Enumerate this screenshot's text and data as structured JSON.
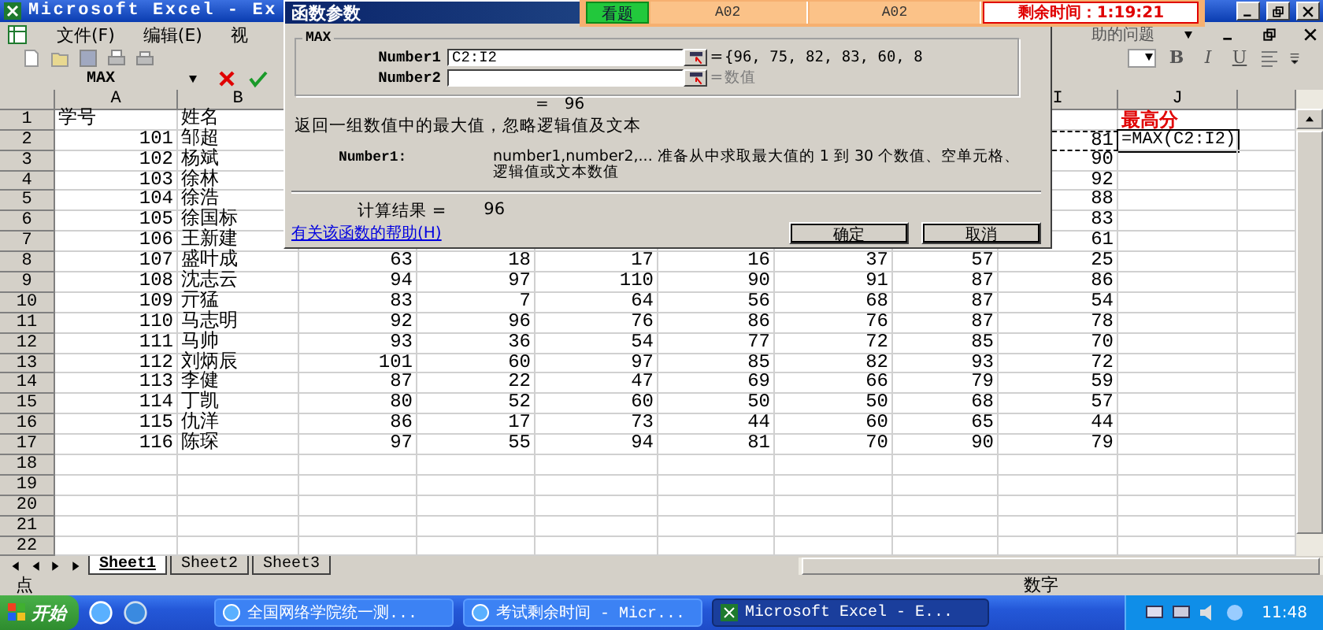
{
  "window": {
    "title": "Microsoft Excel - Ex"
  },
  "menu": [
    "文件(F)",
    "编辑(E)",
    "视"
  ],
  "help_question": "助的问题",
  "format_buttons": [
    "B",
    "I",
    "U"
  ],
  "name_box": "MAX",
  "exam_bar": {
    "view_button": "看题",
    "fields": [
      "A02",
      "A02"
    ],
    "timer": "剩余时间：1:19:21"
  },
  "columns": [
    "A",
    "B",
    null,
    null,
    null,
    null,
    null,
    null,
    "I",
    "J"
  ],
  "rows": [
    {
      "n": "1",
      "kind": "header",
      "cells": [
        "学号",
        "姓名",
        null,
        null,
        null,
        null,
        null,
        null,
        null
      ],
      "j": {
        "kind": "title",
        "text": "最高分"
      }
    },
    {
      "n": "2",
      "kind": "data",
      "reference": true,
      "cells": [
        "101",
        "邹超",
        null,
        null,
        null,
        null,
        null,
        null,
        "81"
      ],
      "j": {
        "kind": "formula",
        "text": "=MAX(C2:I2)"
      }
    },
    {
      "n": "3",
      "kind": "data",
      "cells": [
        "102",
        "杨斌",
        null,
        null,
        null,
        null,
        null,
        null,
        "90"
      ]
    },
    {
      "n": "4",
      "kind": "data",
      "cells": [
        "103",
        "徐林",
        null,
        null,
        null,
        null,
        null,
        null,
        "92"
      ]
    },
    {
      "n": "5",
      "kind": "data",
      "cells": [
        "104",
        "徐浩",
        null,
        null,
        null,
        null,
        null,
        null,
        "88"
      ]
    },
    {
      "n": "6",
      "kind": "data",
      "cells": [
        "105",
        "徐国标",
        null,
        null,
        null,
        null,
        null,
        null,
        "83"
      ]
    },
    {
      "n": "7",
      "kind": "data",
      "cells": [
        "106",
        "王新建",
        null,
        null,
        null,
        null,
        null,
        null,
        "61"
      ]
    },
    {
      "n": "8",
      "kind": "data",
      "cells": [
        "107",
        "盛叶成",
        "63",
        "18",
        "17",
        "16",
        "37",
        "57",
        "25"
      ]
    },
    {
      "n": "9",
      "kind": "data",
      "cells": [
        "108",
        "沈志云",
        "94",
        "97",
        "110",
        "90",
        "91",
        "87",
        "86"
      ]
    },
    {
      "n": "10",
      "kind": "data",
      "cells": [
        "109",
        "亓猛",
        "83",
        "7",
        "64",
        "56",
        "68",
        "87",
        "54"
      ]
    },
    {
      "n": "11",
      "kind": "data",
      "cells": [
        "110",
        "马志明",
        "92",
        "96",
        "76",
        "86",
        "76",
        "87",
        "78"
      ]
    },
    {
      "n": "12",
      "kind": "data",
      "cells": [
        "111",
        "马帅",
        "93",
        "36",
        "54",
        "77",
        "72",
        "85",
        "70"
      ]
    },
    {
      "n": "13",
      "kind": "data",
      "cells": [
        "112",
        "刘炳辰",
        "101",
        "60",
        "97",
        "85",
        "82",
        "93",
        "72"
      ]
    },
    {
      "n": "14",
      "kind": "data",
      "cells": [
        "113",
        "李健",
        "87",
        "22",
        "47",
        "69",
        "66",
        "79",
        "59"
      ]
    },
    {
      "n": "15",
      "kind": "data",
      "cells": [
        "114",
        "丁凯",
        "80",
        "52",
        "60",
        "50",
        "50",
        "68",
        "57"
      ]
    },
    {
      "n": "16",
      "kind": "data",
      "cells": [
        "115",
        "仇洋",
        "86",
        "17",
        "73",
        "44",
        "60",
        "65",
        "44"
      ]
    },
    {
      "n": "17",
      "kind": "data",
      "cells": [
        "116",
        "陈琛",
        "97",
        "55",
        "94",
        "81",
        "70",
        "90",
        "79"
      ]
    },
    {
      "n": "18",
      "kind": "data"
    },
    {
      "n": "19",
      "kind": "data"
    },
    {
      "n": "20",
      "kind": "data"
    },
    {
      "n": "21",
      "kind": "data"
    },
    {
      "n": "22",
      "kind": "data"
    }
  ],
  "dialog": {
    "title": "函数参数",
    "function": "MAX",
    "args": [
      {
        "label": "Number1",
        "value": "C2:I2",
        "eq": "=",
        "result": "{96, 75, 82, 83, 60, 8",
        "dimmed": false
      },
      {
        "label": "Number2",
        "eq": "=",
        "result": "数值",
        "dimmed": true
      }
    ],
    "formula_result": {
      "eq": "=",
      "value": "96"
    },
    "description": "返回一组数值中的最大值，忽略逻辑值及文本",
    "arg_help": {
      "label": "Number1:",
      "text": "number1,number2,...  准备从中求取最大值的 1 到 30 个数值、空单元格、逻辑值或文本数值"
    },
    "calc": {
      "label": "计算结果 =",
      "value": "96"
    },
    "help_link": "有关该函数的帮助(H)",
    "buttons": [
      "确定",
      "取消"
    ]
  },
  "sheet_tabs": [
    {
      "label": "Sheet1",
      "selected": true
    },
    {
      "label": "Sheet2",
      "selected": false
    },
    {
      "label": "Sheet3",
      "selected": false
    }
  ],
  "status_bar": {
    "left": "点",
    "right": "数字"
  },
  "taskbar": {
    "start": "开始",
    "tasks": [
      {
        "label": "全国网络学院统一测...",
        "active": false
      },
      {
        "label": "考试剩余时间 - Micr...",
        "active": false
      },
      {
        "label": "Microsoft Excel - E...",
        "active": true
      }
    ],
    "clock": "11:48"
  }
}
